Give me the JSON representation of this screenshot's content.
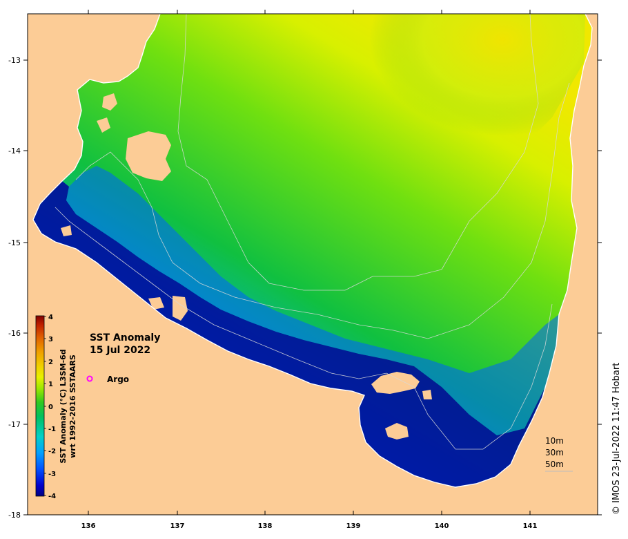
{
  "title_line1": "SST Anomaly",
  "title_line2": "15 Jul 2022",
  "legend_argo": "Argo",
  "colorbar_label_line1": "SST Anomaly (°C) L3SM-6d",
  "colorbar_label_line2": "wrt 1992-2016 SSTAARS",
  "colorbar_ticks": [
    "4",
    "3",
    "2",
    "1",
    "0",
    "-1",
    "-2",
    "-3",
    "-4"
  ],
  "depth_legend": [
    "10m",
    "30m",
    "50m"
  ],
  "credit": "© IMOS 23-Jul-2022 11:47 Hobart",
  "x_ticks": [
    "136",
    "137",
    "138",
    "139",
    "140",
    "141"
  ],
  "y_ticks": [
    "-13",
    "-14",
    "-15",
    "-16",
    "-17",
    "-18"
  ],
  "colors": {
    "land": "#fccc96",
    "anomaly_scale": [
      "#000080",
      "#0000cd",
      "#0050ff",
      "#00a0ff",
      "#00d0c8",
      "#00c060",
      "#20c020",
      "#80e000",
      "#e0f000",
      "#f0e000",
      "#f0a000",
      "#e06000",
      "#c02000",
      "#800000"
    ],
    "argo_marker": "#ff00ff"
  }
}
